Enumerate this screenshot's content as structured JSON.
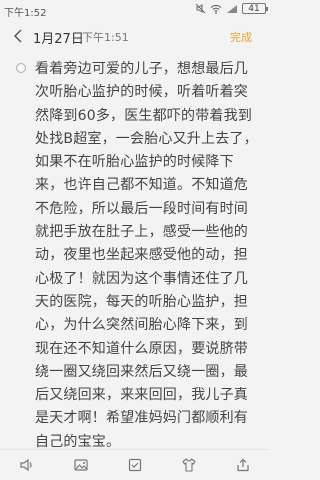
{
  "status_bar": {
    "time": "下午1:52",
    "battery": "41",
    "icons": [
      "mute-icon",
      "wifi-icon",
      "signal-icon",
      "battery-icon"
    ]
  },
  "header": {
    "date": "1月27日",
    "time": "下午1:51",
    "done_label": "完成"
  },
  "note": {
    "text": "看着旁边可爱的儿子，想想最后几次听胎心监护的时候，听着听着突然降到60多，医生都吓的带着我到处找B超室，一会胎心又升上去了，如果不在听胎心监护的时候降下来，也许自己都不知道。不知道危不危险，所以最后一段时间有时间就把手放在肚子上，感受一些他的动，夜里也坐起来感受他的动，担心极了！就因为这个事情还住了几天的医院，每天的听胎心监护，担心，为什么突然间胎心降下来，到现在还不知道什么原因，要说脐带绕一圈又绕回来然后又绕一圈，最后又绕回来，来来回回，我儿子真是天才啊！希望准妈妈门都顺利有自己的宝宝。"
  },
  "toolbar": {
    "items": [
      "sound-icon",
      "image-icon",
      "checklist-icon",
      "clothing-icon",
      "share-icon"
    ]
  },
  "colors": {
    "accent": "#e7a431",
    "background": "#f3f3f3",
    "text": "#444444"
  }
}
